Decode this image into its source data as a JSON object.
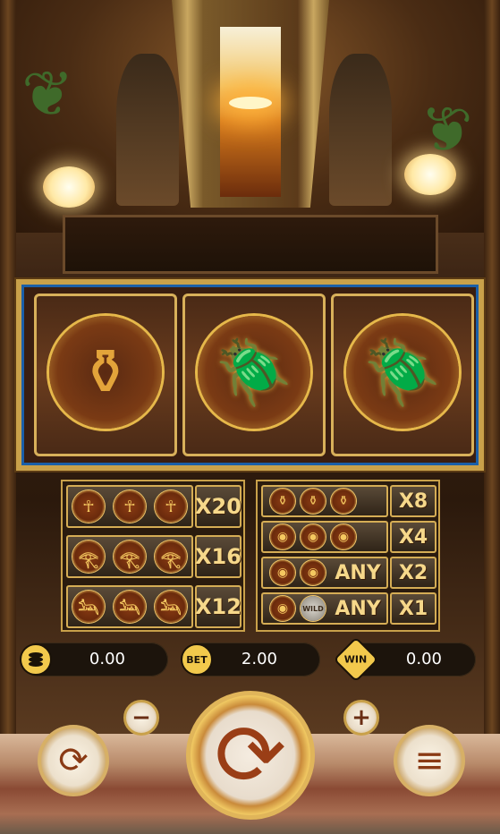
{
  "colors": {
    "gold": "#c9a14a",
    "win_text": "#f6d88a",
    "coin_yellow": "#f2c94c",
    "panel_bg": "#1c140c"
  },
  "reels": [
    {
      "symbol": "urn-icon",
      "glyph": "⚱"
    },
    {
      "symbol": "scarab-icon",
      "glyph": "🪲"
    },
    {
      "symbol": "scarab-icon",
      "glyph": "🪲"
    }
  ],
  "paytable": {
    "left": [
      {
        "symbol": "pharaoh-icon",
        "glyph": "☥",
        "count": 3,
        "multiplier": "X20"
      },
      {
        "symbol": "eye-of-horus-icon",
        "glyph": "𓂀",
        "count": 3,
        "multiplier": "X16"
      },
      {
        "symbol": "anubis-icon",
        "glyph": "𓃢",
        "count": 3,
        "multiplier": "X12"
      }
    ],
    "right": [
      {
        "symbol": "urn-icon",
        "glyph": "⚱",
        "count": 3,
        "multiplier": "X8"
      },
      {
        "symbol": "scarab-icon",
        "glyph": "◉",
        "count": 3,
        "multiplier": "X4"
      },
      {
        "symbol": "bronze-coin-icon",
        "glyph": "◉",
        "count": 2,
        "any": "ANY",
        "multiplier": "X2"
      },
      {
        "symbol": "bronze-coin-icon",
        "glyph": "◉",
        "count": 1,
        "wild": "WILD",
        "any": "ANY",
        "multiplier": "X1"
      }
    ]
  },
  "stats": {
    "balance": {
      "icon": "coins-icon",
      "icon_text": "",
      "value": "0.00"
    },
    "bet": {
      "icon": "bet-chip-icon",
      "icon_text": "BET",
      "value": "2.00"
    },
    "win": {
      "icon": "win-badge-icon",
      "icon_text": "WIN",
      "value": "0.00"
    }
  },
  "controls": {
    "minus": "−",
    "plus": "+",
    "autoplay": "⟳",
    "spin": "⟳",
    "menu": "≡"
  }
}
